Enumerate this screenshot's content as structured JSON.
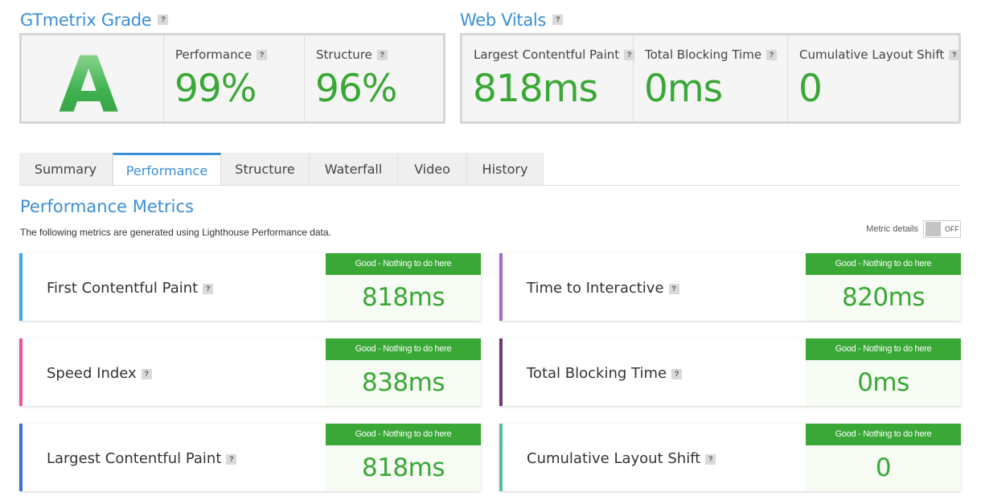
{
  "grade": {
    "title": "GTmetrix Grade",
    "letter": "A",
    "performance_label": "Performance",
    "performance_value": "99%",
    "structure_label": "Structure",
    "structure_value": "96%"
  },
  "web_vitals": {
    "title": "Web Vitals",
    "lcp_label": "Largest Contentful Paint",
    "lcp_value": "818ms",
    "tbt_label": "Total Blocking Time",
    "tbt_value": "0ms",
    "cls_label": "Cumulative Layout Shift",
    "cls_value": "0"
  },
  "help_glyph": "?",
  "tabs": [
    {
      "label": "Summary"
    },
    {
      "label": "Performance"
    },
    {
      "label": "Structure"
    },
    {
      "label": "Waterfall"
    },
    {
      "label": "Video"
    },
    {
      "label": "History"
    }
  ],
  "performance": {
    "title": "Performance Metrics",
    "description": "The following metrics are generated using Lighthouse Performance data.",
    "metric_details_label": "Metric details",
    "toggle_state": "OFF"
  },
  "metrics": [
    {
      "name": "First Contentful Paint",
      "status": "Good - Nothing to do here",
      "value": "818ms",
      "color": "#3fa9f5"
    },
    {
      "name": "Time to Interactive",
      "status": "Good - Nothing to do here",
      "value": "820ms",
      "color": "#a36ccf"
    },
    {
      "name": "Speed Index",
      "status": "Good - Nothing to do here",
      "value": "838ms",
      "color": "#e8579a"
    },
    {
      "name": "Total Blocking Time",
      "status": "Good - Nothing to do here",
      "value": "0ms",
      "color": "#6c3f6e"
    },
    {
      "name": "Largest Contentful Paint",
      "status": "Good - Nothing to do here",
      "value": "818ms",
      "color": "#3f6fd6"
    },
    {
      "name": "Cumulative Layout Shift",
      "status": "Good - Nothing to do here",
      "value": "0",
      "color": "#4fc2a0"
    }
  ],
  "colors": {
    "accent": "#3b8fd6",
    "good": "#3aa836"
  }
}
